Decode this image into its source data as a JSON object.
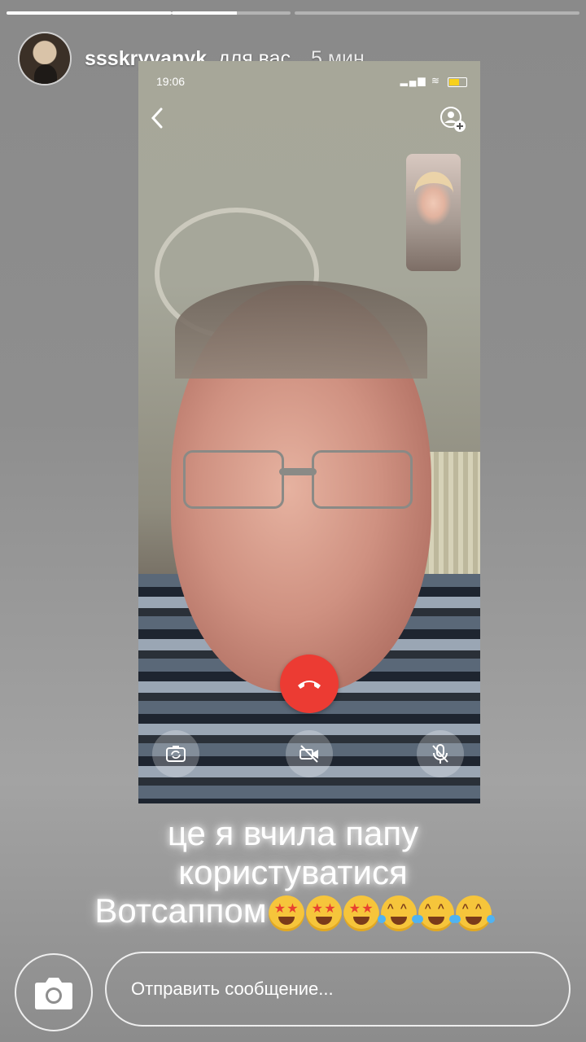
{
  "story": {
    "progress": [
      1,
      0.55,
      0
    ]
  },
  "header": {
    "username": "ssskryvanyk",
    "for_you": "для вас",
    "time_ago": "5 мин."
  },
  "screenshot": {
    "status_time": "19:06",
    "status_signal": "▂▄▆ ≋",
    "icons": [
      "back-icon",
      "add-participant-icon",
      "end-call-icon",
      "flip-camera-icon",
      "video-off-icon",
      "mute-mic-icon"
    ],
    "end_call_color": "#ec3b33"
  },
  "caption": {
    "line1": "це я вчила папу",
    "line2": "користуватися",
    "line3": "Вотсаппом",
    "emojis": [
      "star-struck-emoji",
      "star-struck-emoji",
      "star-struck-emoji",
      "tears-of-joy-emoji",
      "tears-of-joy-emoji",
      "tears-of-joy-emoji"
    ]
  },
  "bottom": {
    "message_placeholder": "Отправить сообщение..."
  }
}
